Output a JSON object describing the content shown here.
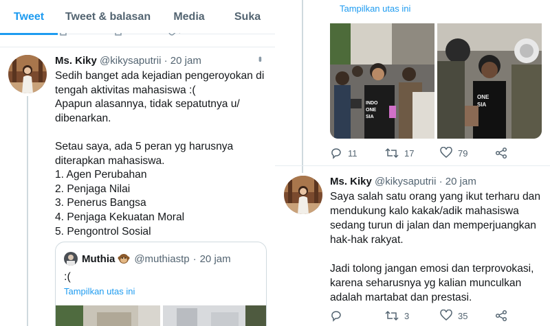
{
  "tabs": [
    {
      "label": "Tweet",
      "active": true
    },
    {
      "label": "Tweet & balasan",
      "active": false
    },
    {
      "label": "Media",
      "active": false
    },
    {
      "label": "Suka",
      "active": false
    }
  ],
  "tweet_left": {
    "name": "Ms. Kiky",
    "handle": "@kikysaputrii",
    "separator": "·",
    "time": "20 jam",
    "lines": [
      "Sedih banget ada kejadian pengeroyokan di",
      "tengah aktivitas mahasiswa :(",
      "Apapun alasannya, tidak sepatutnya u/",
      "dibenarkan.",
      "",
      "Setau saya, ada 5 peran yg harusnya",
      "diterapkan mahasiswa.",
      "1. Agen Perubahan",
      "2. Penjaga Nilai",
      "3. Penerus Bangsa",
      "4. Penjaga Kekuatan Moral",
      "5. Pengontrol Sosial"
    ]
  },
  "quote": {
    "name": "Muthia",
    "emoji": "monkey-emoji",
    "handle": "@muthiastp",
    "separator": "·",
    "time": "20 jam",
    "text": ":(",
    "show_thread": "Tampilkan utas ini"
  },
  "right_top": {
    "show_thread": "Tampilkan utas ini",
    "image1_shirt_text": [
      "INDO",
      "ONE",
      "SIA"
    ],
    "image2_shirt_text": [
      "ONE",
      "SIA"
    ],
    "actions": {
      "replies": "11",
      "retweets": "17",
      "likes": "79"
    }
  },
  "tweet_right": {
    "name": "Ms. Kiky",
    "handle": "@kikysaputrii",
    "separator": "·",
    "time": "20 jam",
    "lines": [
      "Saya salah satu orang yang ikut terharu dan",
      "mendukung kalo kakak/adik mahasiswa",
      "sedang turun di jalan dan memperjuangkan",
      "hak-hak rakyat.",
      "",
      "Jadi tolong jangan emosi dan terprovokasi,",
      "karena seharusnya yg kalian munculkan",
      "adalah martabat dan prestasi."
    ],
    "actions": {
      "replies": "",
      "retweets": "3",
      "likes": "35"
    }
  },
  "colors": {
    "accent": "#1d9bf0",
    "muted": "#536471",
    "border": "#e6ecf0",
    "thread": "#cfd9de"
  },
  "icons": [
    "reply-icon",
    "retweet-icon",
    "like-icon",
    "share-icon",
    "more-icon"
  ]
}
